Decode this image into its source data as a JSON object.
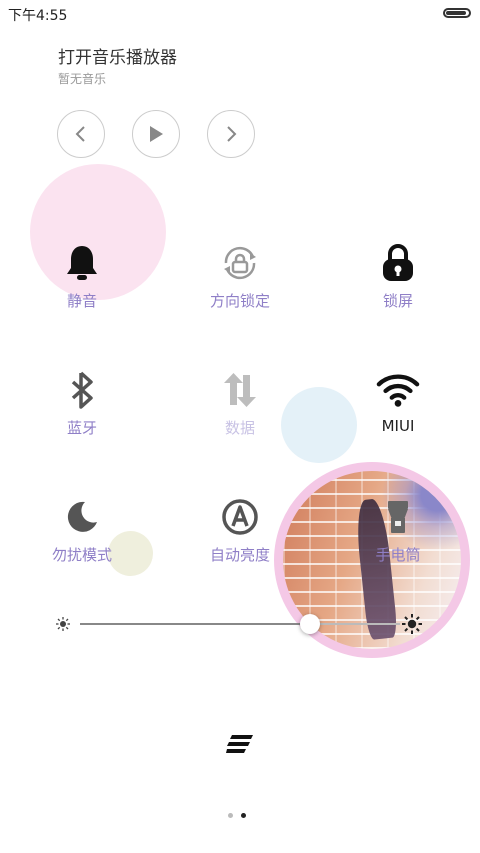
{
  "status_bar": {
    "time": "下午4:55",
    "battery_level": 0.9
  },
  "music": {
    "title": "打开音乐播放器",
    "subtitle": "暂无音乐",
    "controls": {
      "prev_icon": "chevron-left-icon",
      "play_icon": "play-icon",
      "next_icon": "chevron-right-icon"
    }
  },
  "toggles": [
    {
      "id": "mute",
      "label": "静音",
      "icon": "bell-icon"
    },
    {
      "id": "rotation-lock",
      "label": "方向锁定",
      "icon": "rotation-lock-icon"
    },
    {
      "id": "lock-screen",
      "label": "锁屏",
      "icon": "padlock-icon"
    },
    {
      "id": "bluetooth",
      "label": "蓝牙",
      "icon": "bluetooth-icon"
    },
    {
      "id": "data",
      "label": "数据",
      "icon": "data-transfer-icon"
    },
    {
      "id": "wifi",
      "label": "MIUI",
      "icon": "wifi-icon"
    },
    {
      "id": "do-not-disturb",
      "label": "勿扰模式",
      "icon": "moon-icon"
    },
    {
      "id": "auto-brightness",
      "label": "自动亮度",
      "icon": "auto-brightness-icon"
    },
    {
      "id": "flashlight",
      "label": "手电筒",
      "icon": "flashlight-icon"
    }
  ],
  "brightness": {
    "level": 0.72,
    "min_icon": "sun-small-icon",
    "max_icon": "sun-large-icon"
  },
  "pager": {
    "pages": 2,
    "current": 2
  },
  "colors": {
    "label": "#8f7fc7",
    "icon_dark": "#222222",
    "icon_gray": "#777777",
    "blob_pink": "#fbe3f0",
    "blob_blue": "#e4f1f8",
    "blob_cream": "#efefdd",
    "photo_ring": "#f4c8e6"
  }
}
